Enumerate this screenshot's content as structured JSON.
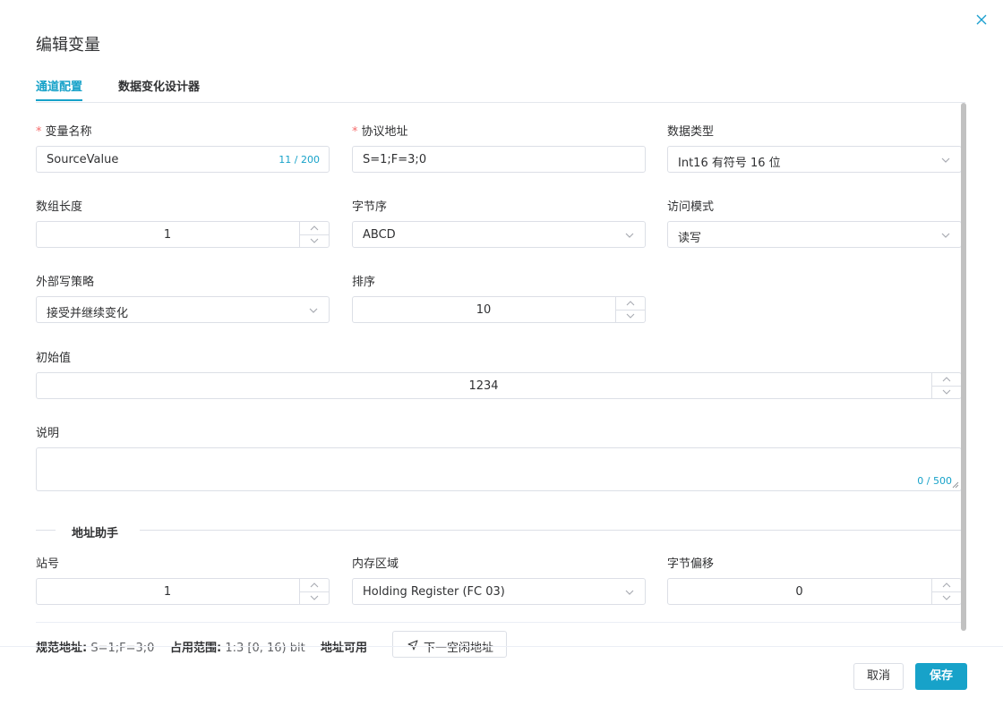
{
  "dialog": {
    "title": "编辑变量"
  },
  "tabs": [
    {
      "label": "通道配置",
      "active": true
    },
    {
      "label": "数据变化设计器",
      "active": false
    }
  ],
  "form": {
    "var_name": {
      "label": "变量名称",
      "required": true,
      "value": "SourceValue",
      "count": "11 / 200"
    },
    "protocol_addr": {
      "label": "协议地址",
      "required": true,
      "value": "S=1;F=3;0"
    },
    "data_type": {
      "label": "数据类型",
      "value": "Int16 有符号 16 位"
    },
    "array_len": {
      "label": "数组长度",
      "value": "1"
    },
    "byte_order": {
      "label": "字节序",
      "value": "ABCD"
    },
    "access_mode": {
      "label": "访问模式",
      "value": "读写"
    },
    "ext_write": {
      "label": "外部写策略",
      "value": "接受并继续变化"
    },
    "sort": {
      "label": "排序",
      "value": "10"
    },
    "initial": {
      "label": "初始值",
      "value": "1234"
    },
    "desc": {
      "label": "说明",
      "value": "",
      "count": "0 / 500"
    }
  },
  "helper": {
    "title": "地址助手",
    "station": {
      "label": "站号",
      "value": "1"
    },
    "memory": {
      "label": "内存区域",
      "value": "Holding Register (FC 03)"
    },
    "offset": {
      "label": "字节偏移",
      "value": "0"
    },
    "norm_addr_label": "规范地址:",
    "norm_addr_value": "S=1;F=3;0",
    "range_label": "占用范围:",
    "range_value": "1:3 [0, 16) bit",
    "available": "地址可用",
    "next_free": "下一空闲地址"
  },
  "footer": {
    "cancel": "取消",
    "save": "保存"
  },
  "colors": {
    "accent": "#17a2c9",
    "required": "#f56c6c",
    "border": "#dcdfe6"
  },
  "icons": [
    "close-icon",
    "chevron-down-icon",
    "chevron-up-icon",
    "navigation-arrow-icon"
  ]
}
